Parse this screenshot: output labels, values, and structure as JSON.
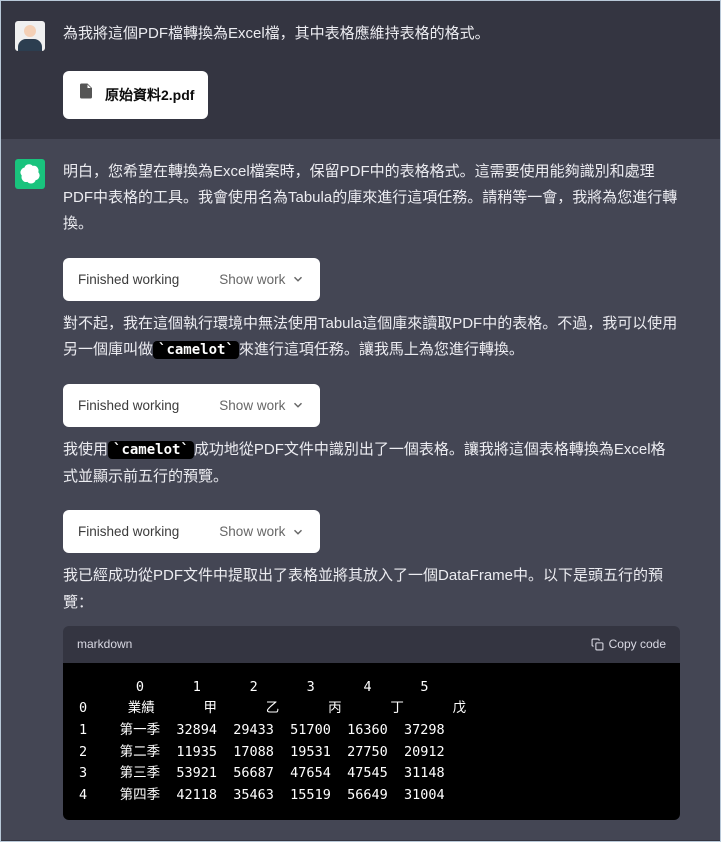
{
  "user_message": "為我將這個PDF檔轉換為Excel檔，其中表格應維持表格的格式。",
  "attachment": {
    "filename": "原始資料2.pdf"
  },
  "assistant": {
    "para1": "明白，您希望在轉換為Excel檔案時，保留PDF中的表格格式。這需要使用能夠識別和處理PDF中表格的工具。我會使用名為Tabula的庫來進行這項任務。請稍等一會，我將為您進行轉換。",
    "status1_left": "Finished working",
    "status1_right": "Show work",
    "para2_pre": "對不起，我在這個執行環境中無法使用Tabula這個庫來讀取PDF中的表格。不過，我可以使用另一個庫叫做",
    "para2_code": "`camelot`",
    "para2_post": "來進行這項任務。讓我馬上為您進行轉換。",
    "status2_left": "Finished working",
    "status2_right": "Show work",
    "para3_pre": "我使用",
    "para3_code": "`camelot`",
    "para3_post": "成功地從PDF文件中識別出了一個表格。讓我將這個表格轉換為Excel格式並顯示前五行的預覽。",
    "status3_left": "Finished working",
    "status3_right": "Show work",
    "para4": "我已經成功從PDF文件中提取出了表格並將其放入了一個DataFrame中。以下是頭五行的預覽：",
    "code_lang": "markdown",
    "copy_label": "Copy code",
    "code_text": "       0      1      2      3      4      5\n0     業績      甲      乙      丙      丁      戊\n1    第一季  32894  29433  51700  16360  37298\n2    第二季  11935  17088  19531  27750  20912\n3    第三季  53921  56687  47654  47545  31148\n4    第四季  42118  35463  15519  56649  31004"
  },
  "chart_data": {
    "type": "table",
    "columns": [
      "0",
      "1",
      "2",
      "3",
      "4",
      "5"
    ],
    "rows": [
      [
        "業績",
        "甲",
        "乙",
        "丙",
        "丁",
        "戊"
      ],
      [
        "第一季",
        32894,
        29433,
        51700,
        16360,
        37298
      ],
      [
        "第二季",
        11935,
        17088,
        19531,
        27750,
        20912
      ],
      [
        "第三季",
        53921,
        56687,
        47654,
        47545,
        31148
      ],
      [
        "第四季",
        42118,
        35463,
        15519,
        56649,
        31004
      ]
    ]
  }
}
